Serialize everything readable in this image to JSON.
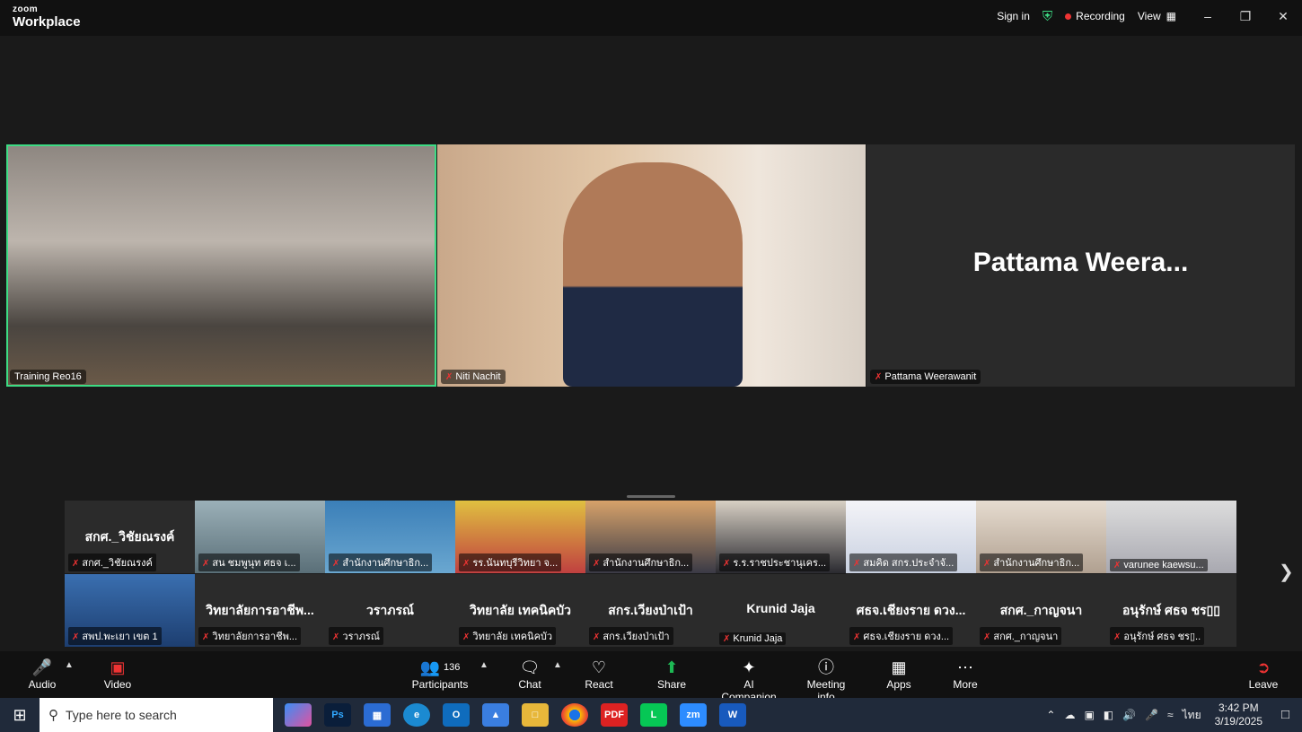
{
  "app": {
    "logo_top": "zoom",
    "logo_bottom": "Workplace"
  },
  "titlebar": {
    "sign_in": "Sign in",
    "recording": "Recording",
    "view": "View"
  },
  "main_tiles": [
    {
      "name": "Training Reo16",
      "active": true
    },
    {
      "name": "Niti Nachit",
      "active": false
    },
    {
      "name": "Pattama Weerawanit",
      "display": "Pattama  Weera...",
      "active": false
    }
  ],
  "gallery": [
    {
      "center": "สกศ._วิชัยณรงค์",
      "tag": "สกศ._วิชัยณรงค์"
    },
    {
      "center": "",
      "tag": "สน ชมพูนุท ศธจ เ..."
    },
    {
      "center": "",
      "tag": "สำนักงานศึกษาธิก..."
    },
    {
      "center": "",
      "tag": "รร.นันทบุรีวิทยา จ..."
    },
    {
      "center": "",
      "tag": "สำนักงานศึกษาธิก..."
    },
    {
      "center": "",
      "tag": "ร.ร.ราชประชานุเคร..."
    },
    {
      "center": "",
      "tag": "สมคิด สกร.ประจำจั..."
    },
    {
      "center": "",
      "tag": "สำนักงานศึกษาธิก..."
    },
    {
      "center": "",
      "tag": "varunee kaewsu..."
    },
    {
      "center": "",
      "tag": "สพป.พะเยา เขต 1"
    },
    {
      "center": "วิทยาลัยการอาชีพ...",
      "tag": "วิทยาลัยการอาชีพ..."
    },
    {
      "center": "วราภรณ์",
      "tag": "วราภรณ์"
    },
    {
      "center": "วิทยาลัย เทคนิคบัว",
      "tag": "วิทยาลัย เทคนิคบัว"
    },
    {
      "center": "สกร.เวียงป่าเป้า",
      "tag": "สกร.เวียงป่าเป้า"
    },
    {
      "center": "Krunid Jaja",
      "tag": "Krunid Jaja"
    },
    {
      "center": "ศธจ.เชียงราย ดวง...",
      "tag": "ศธจ.เชียงราย ดวง..."
    },
    {
      "center": "สกศ._กาญจนา",
      "tag": "สกศ._กาญจนา"
    },
    {
      "center": "อนุรักษ์ ศธจ ชร▯▯",
      "tag": "อนุรักษ์ ศธจ ชร▯.."
    }
  ],
  "toolbar": {
    "audio": "Audio",
    "video": "Video",
    "participants": "Participants",
    "participants_count": "136",
    "chat": "Chat",
    "react": "React",
    "share": "Share",
    "ai_companion": "AI Companion",
    "meeting_info": "Meeting info",
    "apps": "Apps",
    "more": "More",
    "leave": "Leave"
  },
  "taskbar": {
    "search_placeholder": "Type here to search",
    "lang": "ไทย",
    "time": "3:42 PM",
    "date": "3/19/2025"
  },
  "colors": {
    "active_outline": "#3ddc84",
    "recording": "#ee3333",
    "leave": "#ee3333",
    "share": "#1db954"
  }
}
